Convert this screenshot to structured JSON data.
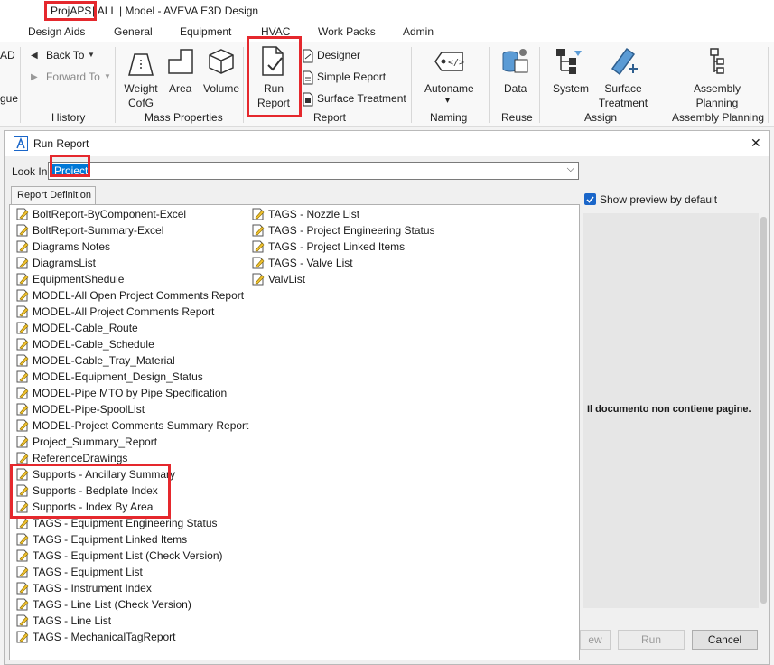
{
  "titlebar": {
    "project": "ProjAPS",
    "rest": " | ALL | Model - AVEVA E3D Design"
  },
  "ribbon_tabs": [
    "Design Aids",
    "General",
    "Equipment",
    "HVAC",
    "Work Packs",
    "Admin"
  ],
  "ribbon": {
    "left_clip_1": "AD",
    "left_clip_2": "gue",
    "history": {
      "back": "Back To",
      "forward": "Forward To",
      "group": "History"
    },
    "mass": {
      "weight_l1": "Weight",
      "weight_l2": "CofG",
      "area": "Area",
      "volume": "Volume",
      "group": "Mass Properties"
    },
    "report": {
      "run_l1": "Run",
      "run_l2": "Report",
      "designer": "Designer",
      "simple": "Simple Report",
      "surface": "Surface Treatment",
      "group": "Report"
    },
    "naming": {
      "autoname": "Autoname",
      "arrow": "▾",
      "group": "Naming"
    },
    "reuse": {
      "data": "Data",
      "group": "Reuse"
    },
    "assign": {
      "system": "System",
      "surface_l1": "Surface",
      "surface_l2": "Treatment",
      "group": "Assign"
    },
    "assembly": {
      "l1": "Assembly",
      "l2": "Planning",
      "group": "Assembly Planning"
    }
  },
  "dialog": {
    "title": "Run Report",
    "close": "✕",
    "lookin_label": "Look In",
    "lookin_value": "Project",
    "tab_label": "Report Definition",
    "preview_checkbox": "Show preview by default",
    "preview_checked": true,
    "no_pages": "Il documento non contiene pagine.",
    "btn_preview_partial": "ew",
    "btn_run": "Run",
    "btn_cancel": "Cancel"
  },
  "reports_col1": [
    "BoltReport-ByComponent-Excel",
    "BoltReport-Summary-Excel",
    "Diagrams Notes",
    "DiagramsList",
    "EquipmentShedule",
    "MODEL-All Open Project Comments Report",
    "MODEL-All Project Comments Report",
    "MODEL-Cable_Route",
    "MODEL-Cable_Schedule",
    "MODEL-Cable_Tray_Material",
    "MODEL-Equipment_Design_Status",
    "MODEL-Pipe MTO by Pipe Specification",
    "MODEL-Pipe-SpoolList",
    "MODEL-Project Comments Summary Report",
    "Project_Summary_Report",
    "ReferenceDrawings",
    "Supports - Ancillary Summary",
    "Supports - Bedplate Index",
    "Supports - Index By Area",
    "TAGS - Equipment Engineering Status",
    "TAGS - Equipment Linked Items",
    "TAGS - Equipment List (Check Version)",
    "TAGS - Equipment List",
    "TAGS - Instrument Index",
    "TAGS - Line List (Check Version)",
    "TAGS - Line List",
    "TAGS - MechanicalTagReport"
  ],
  "reports_col2": [
    "TAGS - Nozzle List",
    "TAGS - Project Engineering Status",
    "TAGS - Project Linked Items",
    "TAGS - Valve List",
    "ValvList"
  ],
  "colors": {
    "highlight": "#e5282d",
    "select": "#0078d7",
    "checkbox": "#1a66c9"
  }
}
